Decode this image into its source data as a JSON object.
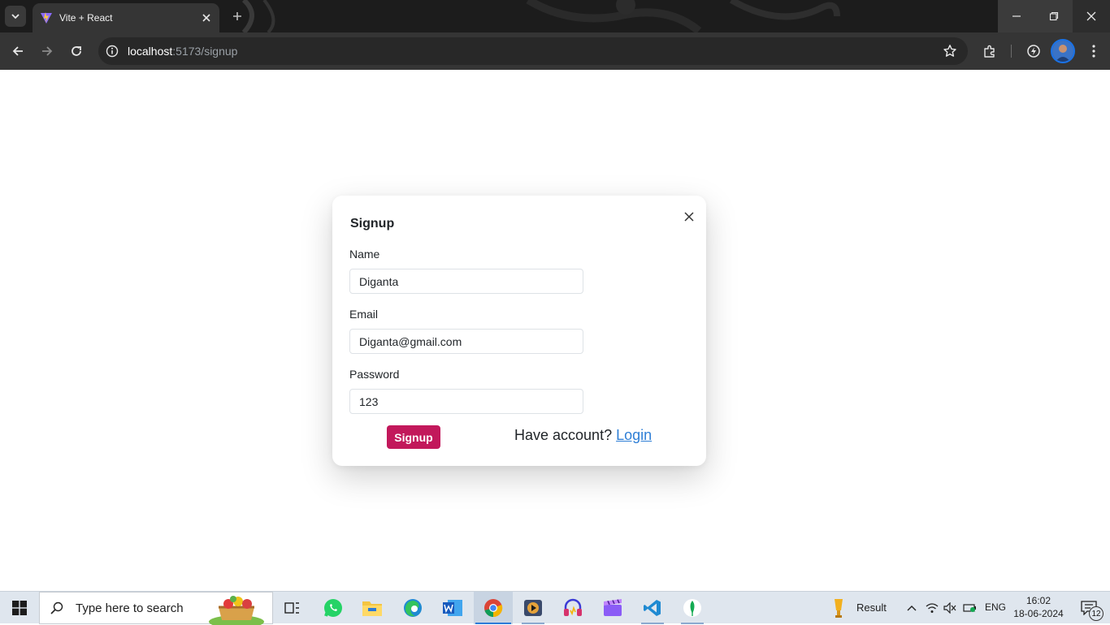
{
  "browser": {
    "tab_title": "Vite + React",
    "url_host": "localhost",
    "url_path": ":5173/signup"
  },
  "signup_modal": {
    "title": "Signup",
    "fields": {
      "name_label": "Name",
      "name_value": "Diganta",
      "email_label": "Email",
      "email_value": "Diganta@gmail.com",
      "password_label": "Password",
      "password_value": "123"
    },
    "submit_label": "Signup",
    "have_account_text": "Have account?",
    "login_link": "Login",
    "accent_color": "#c2185b"
  },
  "taskbar": {
    "search_placeholder": "Type here to search",
    "weather_label": "Result",
    "language": "ENG",
    "time": "16:02",
    "date": "18-06-2024",
    "notification_count": "12"
  }
}
